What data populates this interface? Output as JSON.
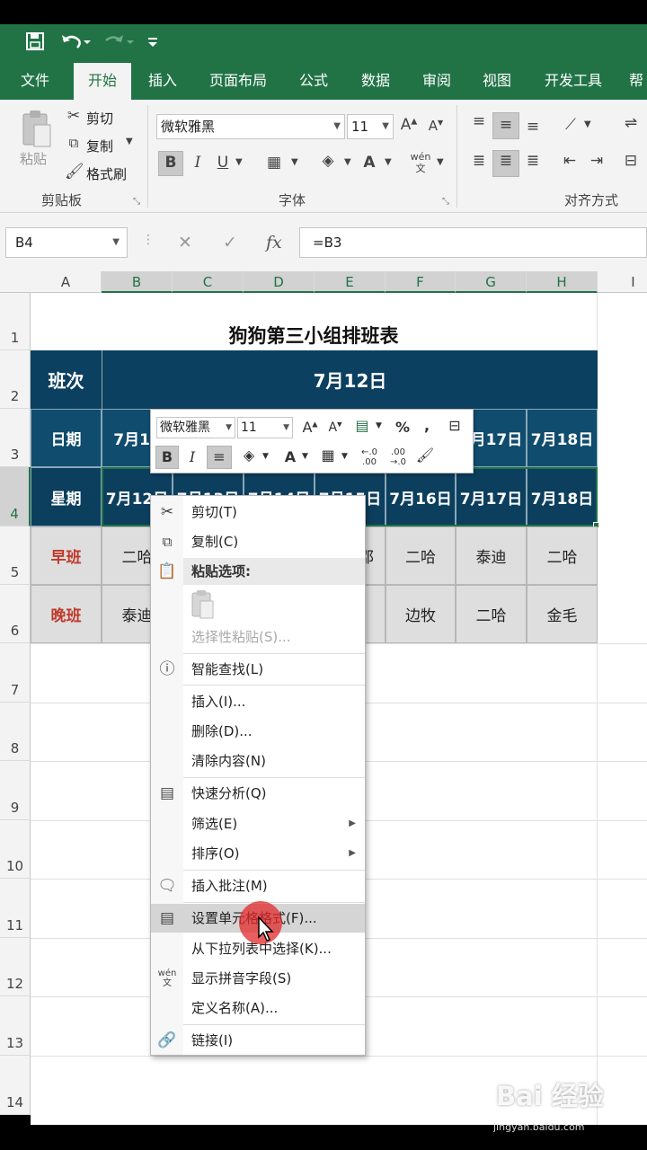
{
  "qat": {
    "save_icon": "save-icon",
    "undo_icon": "undo-icon",
    "redo_icon": "redo-icon",
    "customize_icon": "customize-icon"
  },
  "tabs": [
    "文件",
    "开始",
    "插入",
    "页面布局",
    "公式",
    "数据",
    "审阅",
    "视图",
    "开发工具",
    "帮"
  ],
  "active_tab": "开始",
  "ribbon": {
    "clipboard": {
      "paste": "粘贴",
      "cut": "剪切",
      "copy": "复制",
      "format_painter": "格式刷",
      "label": "剪贴板"
    },
    "font": {
      "name": "微软雅黑",
      "size": "11",
      "bold": "B",
      "italic": "I",
      "underline": "U",
      "label": "字体"
    },
    "align": {
      "label": "对齐方式"
    }
  },
  "namebox": "B4",
  "formula": "=B3",
  "fx": "fx",
  "columns": [
    "A",
    "B",
    "C",
    "D",
    "E",
    "F",
    "G",
    "H",
    "I"
  ],
  "rows": [
    "1",
    "2",
    "3",
    "4",
    "5",
    "6",
    "7",
    "8",
    "9",
    "10",
    "11",
    "12",
    "13",
    "14"
  ],
  "table": {
    "title": "狗狗第三小组排班表",
    "shift_header": "班次",
    "date_header": "7月12日",
    "row_date_label": "日期",
    "row_weekday_label": "星期",
    "date_cells": [
      "7月12",
      "7月17日",
      "7月18日"
    ],
    "weekday_cells": [
      "7月12日",
      "7月13日",
      "7月14日",
      "7月15日",
      "7月16日",
      "7月17日",
      "7月18日"
    ],
    "morning_label": "早班",
    "morning": [
      "二哈",
      "邵",
      "二哈",
      "泰迪",
      "二哈"
    ],
    "evening_label": "晚班",
    "evening": [
      "泰迪",
      "边牧",
      "二哈",
      "金毛"
    ]
  },
  "minibar": {
    "font": "微软雅黑",
    "size": "11",
    "percent": "%",
    "comma": ",",
    "bold": "B",
    "italic": "I",
    "font_color": "A"
  },
  "context_menu": {
    "cut": "剪切(T)",
    "copy": "复制(C)",
    "paste_options": "粘贴选项:",
    "paste_special": "选择性粘贴(S)...",
    "smart_lookup": "智能查找(L)",
    "insert": "插入(I)...",
    "delete": "删除(D)...",
    "clear": "清除内容(N)",
    "quick_analysis": "快速分析(Q)",
    "filter": "筛选(E)",
    "sort": "排序(O)",
    "insert_comment": "插入批注(M)",
    "format_cells": "设置单元格格式(F)...",
    "pick_list": "从下拉列表中选择(K)...",
    "phonetic": "显示拼音字段(S)",
    "define_name": "定义名称(A)...",
    "link": "链接(I)"
  },
  "watermark": "Bai 经验",
  "watermark_url": "jingyan.baidu.com",
  "colors": {
    "excel_green": "#217346",
    "navy": "#0f4c6e",
    "red_text": "#c0392b"
  }
}
